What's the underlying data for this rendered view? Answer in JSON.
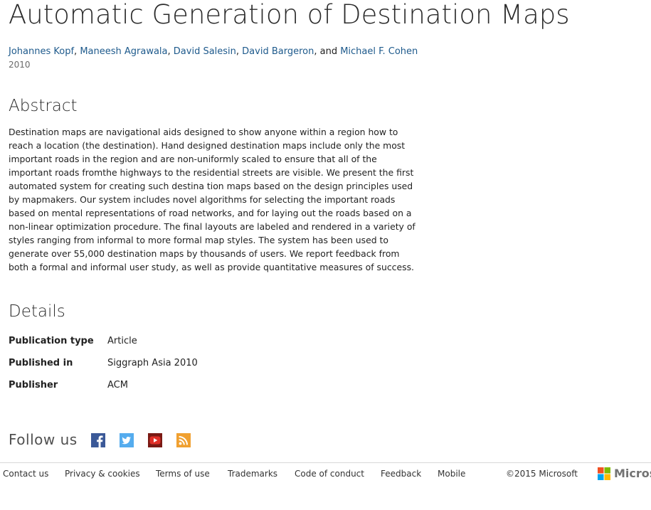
{
  "title": "Automatic Generation of Destination Maps",
  "authors": [
    "Johannes Kopf",
    "Maneesh Agrawala",
    "David Salesin",
    "David Bargeron",
    "Michael F. Cohen"
  ],
  "author_separators": [
    ", ",
    ", ",
    ", ",
    ", and "
  ],
  "year": "2010",
  "abstract": {
    "heading": "Abstract",
    "text": "Destination maps are navigational aids designed to show anyone within a region how to reach a location (the destination). Hand designed destination maps include only the most important roads in the region and are non-uniformly scaled to ensure that all of the important roads fromthe highways to the residential streets are visible. We present the first automated system for creating such destina tion maps based on the design principles used by mapmakers. Our system includes novel algorithms for selecting the important roads based on mental representations of road networks, and for laying out the roads based on a non-linear optimization procedure. The final layouts are labeled and rendered in a variety of styles ranging from informal to more formal map styles. The system has been used to generate over 55,000 destination maps by thousands of users. We report feedback from both a formal and informal user study, as well as provide quantitative measures of success."
  },
  "details": {
    "heading": "Details",
    "rows": [
      {
        "label": "Publication type",
        "value": "Article"
      },
      {
        "label": "Published in",
        "value": "Siggraph Asia 2010"
      },
      {
        "label": "Publisher",
        "value": "ACM"
      }
    ]
  },
  "follow": {
    "label": "Follow us",
    "icons": [
      "facebook-icon",
      "twitter-icon",
      "youtube-icon",
      "rss-icon"
    ]
  },
  "footer": {
    "links": [
      "Contact us",
      "Privacy & cookies",
      "Terms of use",
      "Trademarks",
      "Code of conduct",
      "Feedback",
      "Mobile"
    ],
    "copyright": "©2015 Microsoft",
    "logo_text": "Microsoft"
  },
  "colors": {
    "link": "#1e5a8c",
    "facebook": "#3b5998",
    "twitter": "#55acee",
    "youtube": "#c4302b",
    "rss": "#f0a030",
    "ms_red": "#f25022",
    "ms_green": "#7fba00",
    "ms_blue": "#00a4ef",
    "ms_yellow": "#ffb900"
  }
}
